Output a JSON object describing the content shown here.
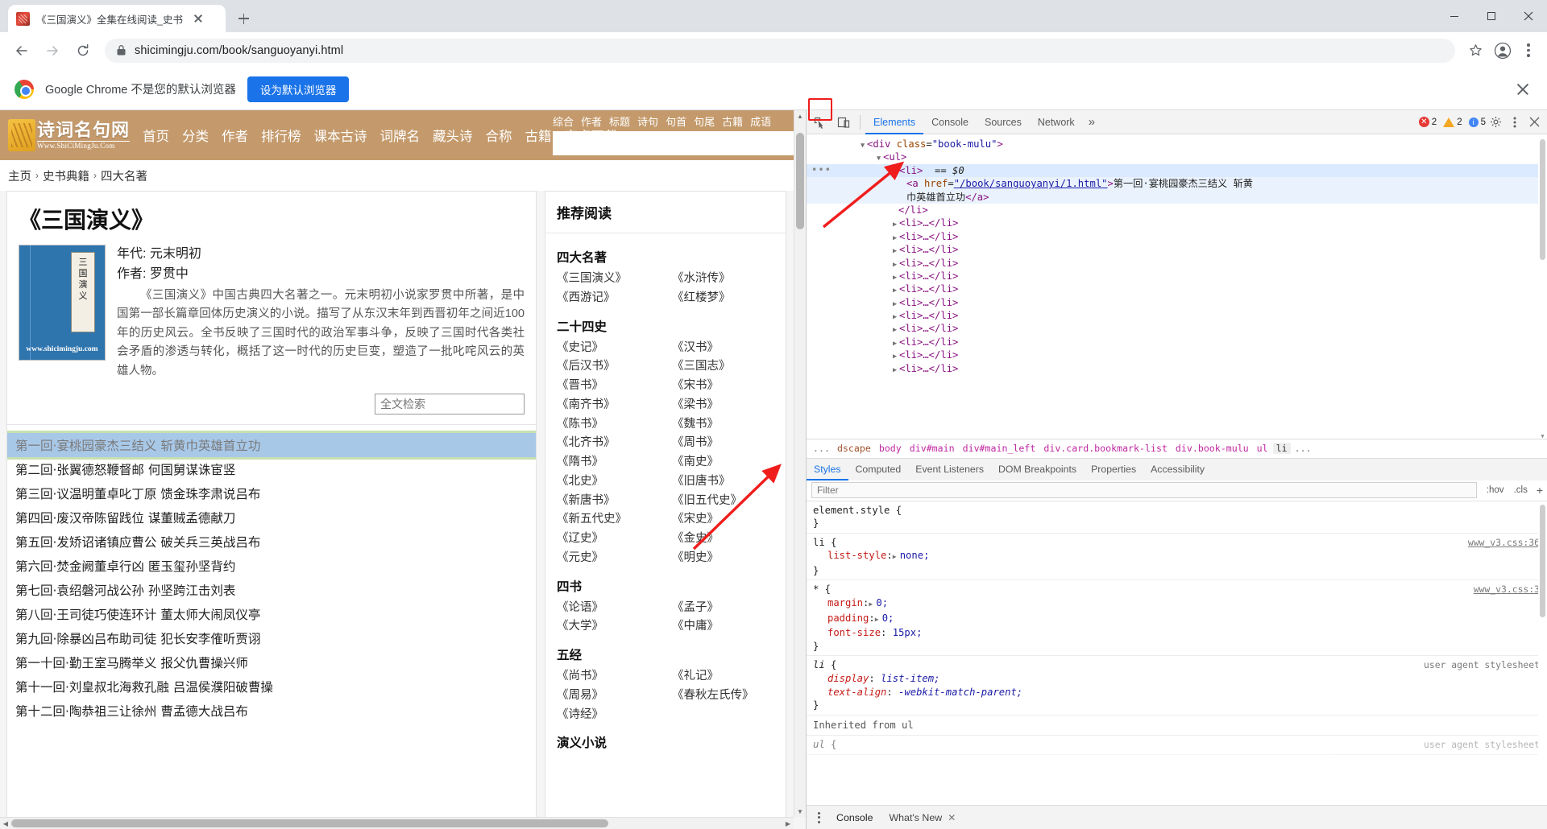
{
  "browser": {
    "tab": {
      "title": "《三国演义》全集在线阅读_史书",
      "favicon": "site-favicon"
    },
    "new_tab_label": "+",
    "url": "shicimingju.com/book/sanguoyanyi.html",
    "window_controls": {
      "minimize": "minimize",
      "maximize": "maximize",
      "close": "close"
    },
    "infobar": {
      "text": "Google Chrome 不是您的默认浏览器",
      "button": "设为默认浏览器",
      "close": "close"
    }
  },
  "site": {
    "logo": {
      "cn": "诗词名句网",
      "en": "Www.ShiCiMingJu.Com"
    },
    "nav": [
      "首页",
      "分类",
      "作者",
      "排行榜",
      "课本古诗",
      "词牌名",
      "藏头诗",
      "合称",
      "古籍",
      "安卓下载"
    ],
    "search_tabs": [
      "综合",
      "作者",
      "标题",
      "诗句",
      "句首",
      "句尾",
      "古籍",
      "成语"
    ],
    "search_tab_active": "综合",
    "search_value": "",
    "breadcrumb": [
      "主页",
      "史书典籍",
      "四大名著"
    ],
    "breadcrumb_sep": "›"
  },
  "book": {
    "title": "《三国演义》",
    "era_label": "年代: 元末明初",
    "author_label": "作者: 罗贯中",
    "description": "《三国演义》中国古典四大名著之一。元末明初小说家罗贯中所著，是中国第一部长篇章回体历史演义的小说。描写了从东汉末年到西晋初年之间近100年的历史风云。全书反映了三国时代的政治军事斗争，反映了三国时代各类社会矛盾的渗透与转化，概括了这一时代的历史巨变，塑造了一批叱咤风云的英雄人物。",
    "cover": {
      "chars": [
        "三",
        "国",
        "演",
        "义"
      ],
      "watermark": "www.shicimingju.com"
    },
    "fulltext_search_placeholder": "全文检索",
    "chapters": [
      "第一回·宴桃园豪杰三结义 斩黄巾英雄首立功",
      "第二回·张翼德怒鞭督邮 何国舅谋诛宦竖",
      "第三回·议温明董卓叱丁原 馈金珠李肃说吕布",
      "第四回·废汉帝陈留践位 谋董贼孟德献刀",
      "第五回·发矫诏诸镇应曹公 破关兵三英战吕布",
      "第六回·焚金阙董卓行凶 匿玉玺孙坚背约",
      "第七回·袁绍磐河战公孙 孙坚跨江击刘表",
      "第八回·王司徒巧使连环计 董太师大闹凤仪亭",
      "第九回·除暴凶吕布助司徒 犯长安李傕听贾诩",
      "第一十回·勤王室马腾举义 报父仇曹操兴师",
      "第十一回·刘皇叔北海救孔融 吕温侯濮阳破曹操",
      "第十二回·陶恭祖三让徐州 曹孟德大战吕布"
    ],
    "selected_chapter_index": 0
  },
  "sidebar": {
    "title": "推荐阅读",
    "groups": [
      {
        "title": "四大名著",
        "items": [
          "《三国演义》",
          "《水浒传》",
          "《西游记》",
          "《红楼梦》"
        ]
      },
      {
        "title": "二十四史",
        "items": [
          "《史记》",
          "《汉书》",
          "《后汉书》",
          "《三国志》",
          "《晋书》",
          "《宋书》",
          "《南齐书》",
          "《梁书》",
          "《陈书》",
          "《魏书》",
          "《北齐书》",
          "《周书》",
          "《隋书》",
          "《南史》",
          "《北史》",
          "《旧唐书》",
          "《新唐书》",
          "《旧五代史》",
          "《新五代史》",
          "《宋史》",
          "《辽史》",
          "《金史》",
          "《元史》",
          "《明史》"
        ]
      },
      {
        "title": "四书",
        "items": [
          "《论语》",
          "《孟子》",
          "《大学》",
          "《中庸》"
        ]
      },
      {
        "title": "五经",
        "items": [
          "《尚书》",
          "《礼记》",
          "《周易》",
          "《春秋左氏传》",
          "《诗经》"
        ]
      },
      {
        "title": "演义小说",
        "items": []
      }
    ]
  },
  "devtools": {
    "inspect_icon": "inspect-element-icon",
    "device_icon": "device-toolbar-icon",
    "tabs": [
      "Elements",
      "Console",
      "Sources",
      "Network"
    ],
    "active_tab": "Elements",
    "more_tabs": "»",
    "counts": {
      "errors": "2",
      "warnings": "2",
      "info": "5"
    },
    "settings_icon": "gear-icon",
    "kebab_icon": "more-options-icon",
    "close_icon": "close-devtools-icon",
    "dom": {
      "line_div_open": {
        "tag": "div",
        "attr": "class",
        "value": "\"book-mulu\""
      },
      "line_ul": "<ul>",
      "line_li_selected": "<li>",
      "selected_marker": "== $0",
      "anchor": {
        "tag": "a",
        "attr": "href",
        "value": "\"/book/sanguoyanyi/1.html\"",
        "text_line1": "第一回·宴桃园豪杰三结义  斩黄",
        "text_line2": "巾英雄首立功",
        "close": "</a>"
      },
      "line_li_close": "</li>",
      "collapsed_li": "<li>…</li>",
      "collapsed_count": 11
    },
    "breadcrumbs": [
      "...",
      "dscape",
      "body",
      "div#main",
      "div#main_left",
      "div.card.bookmark-list",
      "div.book-mulu",
      "ul",
      "li",
      "..."
    ],
    "breadcrumb_selected": "li",
    "style_tabs": [
      "Styles",
      "Computed",
      "Event Listeners",
      "DOM Breakpoints",
      "Properties",
      "Accessibility"
    ],
    "style_tab_active": "Styles",
    "filter_placeholder": "Filter",
    "hov_label": ":hov",
    "cls_label": ".cls",
    "plus_label": "+",
    "rules": [
      {
        "selector": "element.style",
        "source": "",
        "declarations": []
      },
      {
        "selector": "li",
        "source": "www_v3.css:36",
        "declarations": [
          {
            "prop": "list-style",
            "value": "none;"
          }
        ]
      },
      {
        "selector": "*",
        "source": "www_v3.css:3",
        "declarations": [
          {
            "prop": "margin",
            "value": "0;"
          },
          {
            "prop": "padding",
            "value": "0;"
          },
          {
            "prop": "font-size",
            "value": "15px;"
          }
        ]
      },
      {
        "selector": "li",
        "source": "user agent stylesheet",
        "italic": true,
        "declarations": [
          {
            "prop": "display",
            "value": "list-item;"
          },
          {
            "prop": "text-align",
            "value": "-webkit-match-parent;"
          }
        ]
      }
    ],
    "inherited_from": "Inherited from  ul",
    "inherited_rule": {
      "selector": "ul",
      "source": "user agent stylesheet"
    },
    "drawer": {
      "tabs": [
        "Console",
        "What's New"
      ],
      "active": "Console",
      "close_icon": "close-whats-new-icon"
    }
  },
  "colors": {
    "site_header": "#c49a6c",
    "accent_blue": "#1a73e8",
    "selection_blue": "#a8c8e8",
    "selection_outline": "#c7e0ae",
    "annotation_red": "#f01d1d"
  }
}
